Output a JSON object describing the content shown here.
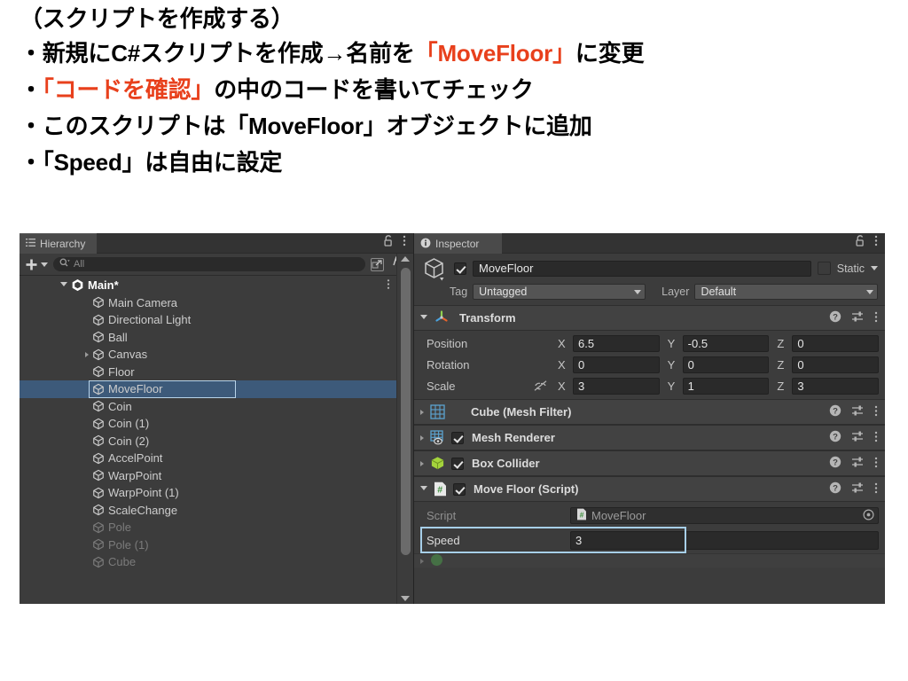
{
  "slide": {
    "lines": [
      {
        "segments": [
          {
            "text": "（スクリプトを作成する）",
            "accent": false
          }
        ]
      },
      {
        "segments": [
          {
            "text": "・新規にC#スクリプトを作成→名前を",
            "accent": false
          },
          {
            "text": "「MoveFloor」",
            "accent": true
          },
          {
            "text": "に変更",
            "accent": false
          }
        ]
      },
      {
        "segments": [
          {
            "text": "・",
            "accent": false
          },
          {
            "text": "「コードを確認」",
            "accent": true
          },
          {
            "text": "の中のコードを書いてチェック",
            "accent": false
          }
        ]
      },
      {
        "segments": [
          {
            "text": "・このスクリプトは「MoveFloor」オブジェクトに追加",
            "accent": false
          }
        ]
      },
      {
        "segments": [
          {
            "text": "・「Speed」は自由に設定",
            "accent": false
          }
        ]
      }
    ],
    "accent_color": "#e8401c"
  },
  "hierarchy": {
    "tab_label": "Hierarchy",
    "tab_icon": "hierarchy-icon",
    "lock_icon": "lock-icon",
    "menu_icon": "kebab-menu-icon",
    "toolbar": {
      "create_label": "+",
      "create_dropdown_icon": "chevron-down-icon",
      "search_icon": "search-icon",
      "search_value": "",
      "search_placeholder": "All",
      "search_extend_icon": "search-extend-icon",
      "sort_icon": "sort-icon"
    },
    "items": [
      {
        "label": "Main*",
        "depth": 0,
        "expanded": true,
        "foldout": "down",
        "icon": "unity-scene-icon",
        "selected": false,
        "dim": false,
        "kebab": true
      },
      {
        "label": "Main Camera",
        "depth": 1,
        "foldout": "none",
        "icon": "gameobject-icon",
        "selected": false,
        "dim": false
      },
      {
        "label": "Directional Light",
        "depth": 1,
        "foldout": "none",
        "icon": "gameobject-icon",
        "selected": false,
        "dim": false
      },
      {
        "label": "Ball",
        "depth": 1,
        "foldout": "none",
        "icon": "gameobject-icon",
        "selected": false,
        "dim": false
      },
      {
        "label": "Canvas",
        "depth": 1,
        "foldout": "right",
        "icon": "gameobject-icon",
        "selected": false,
        "dim": false
      },
      {
        "label": "Floor",
        "depth": 1,
        "foldout": "none",
        "icon": "gameobject-icon",
        "selected": false,
        "dim": false
      },
      {
        "label": "MoveFloor",
        "depth": 1,
        "foldout": "none",
        "icon": "gameobject-icon",
        "selected": true,
        "dim": false
      },
      {
        "label": "Coin",
        "depth": 1,
        "foldout": "none",
        "icon": "gameobject-icon",
        "selected": false,
        "dim": false
      },
      {
        "label": "Coin (1)",
        "depth": 1,
        "foldout": "none",
        "icon": "gameobject-icon",
        "selected": false,
        "dim": false
      },
      {
        "label": "Coin (2)",
        "depth": 1,
        "foldout": "none",
        "icon": "gameobject-icon",
        "selected": false,
        "dim": false
      },
      {
        "label": "AccelPoint",
        "depth": 1,
        "foldout": "none",
        "icon": "gameobject-icon",
        "selected": false,
        "dim": false
      },
      {
        "label": "WarpPoint",
        "depth": 1,
        "foldout": "none",
        "icon": "gameobject-icon",
        "selected": false,
        "dim": false
      },
      {
        "label": "WarpPoint (1)",
        "depth": 1,
        "foldout": "none",
        "icon": "gameobject-icon",
        "selected": false,
        "dim": false
      },
      {
        "label": "ScaleChange",
        "depth": 1,
        "foldout": "none",
        "icon": "gameobject-icon",
        "selected": false,
        "dim": false
      },
      {
        "label": "Pole",
        "depth": 1,
        "foldout": "none",
        "icon": "gameobject-icon",
        "selected": false,
        "dim": true
      },
      {
        "label": "Pole (1)",
        "depth": 1,
        "foldout": "none",
        "icon": "gameobject-icon",
        "selected": false,
        "dim": true
      },
      {
        "label": "Cube",
        "depth": 1,
        "foldout": "none",
        "icon": "gameobject-icon",
        "selected": false,
        "dim": true
      }
    ],
    "selection_color": "#3d5a7a"
  },
  "inspector": {
    "tab_label": "Inspector",
    "tab_icon": "info-icon",
    "lock_icon": "lock-icon",
    "menu_icon": "kebab-menu-icon",
    "gameobject": {
      "icon": "gameobject-icon",
      "enabled": true,
      "name": "MoveFloor",
      "static_label": "Static",
      "static_checked": false,
      "tag_label": "Tag",
      "tag_value": "Untagged",
      "layer_label": "Layer",
      "layer_value": "Default"
    },
    "transform": {
      "title": "Transform",
      "icon": "transform-axis-icon",
      "expanded": true,
      "help_icon": "help-icon",
      "preset_icon": "preset-icon",
      "menu_icon": "kebab-menu-icon",
      "rows": [
        {
          "label": "Position",
          "x": "6.5",
          "y": "-0.5",
          "z": "0",
          "constrain_icon": false
        },
        {
          "label": "Rotation",
          "x": "0",
          "y": "0",
          "z": "0",
          "constrain_icon": false
        },
        {
          "label": "Scale",
          "x": "3",
          "y": "1",
          "z": "3",
          "constrain_icon": true
        }
      ],
      "axis_labels": [
        "X",
        "Y",
        "Z"
      ]
    },
    "components": [
      {
        "title": "Cube (Mesh Filter)",
        "icon": "mesh-filter-icon",
        "expanded": false,
        "has_checkbox": false,
        "checked": false,
        "icon_color": "#5ba3d0"
      },
      {
        "title": "Mesh Renderer",
        "icon": "mesh-renderer-icon",
        "expanded": false,
        "has_checkbox": true,
        "checked": true,
        "icon_color": "#5ba3d0"
      },
      {
        "title": "Box Collider",
        "icon": "box-collider-icon",
        "expanded": false,
        "has_checkbox": true,
        "checked": true,
        "icon_color": "#a4d43c"
      },
      {
        "title": "Move Floor (Script)",
        "icon": "script-icon",
        "expanded": true,
        "has_checkbox": true,
        "checked": true,
        "icon_color": "#ffffff"
      }
    ],
    "script_component": {
      "script_label": "Script",
      "script_value": "MoveFloor",
      "script_icon": "script-icon",
      "picker_icon": "object-picker-icon",
      "speed_label": "Speed",
      "speed_value": "3",
      "highlight_color": "#a7cfe8"
    }
  }
}
